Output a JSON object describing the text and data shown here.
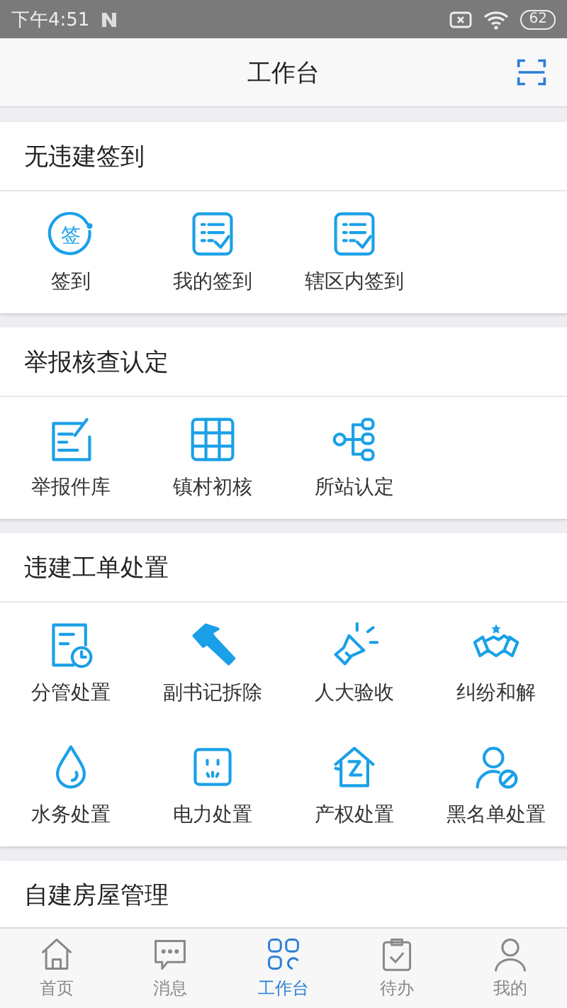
{
  "status_bar": {
    "time": "下午4:51",
    "battery": "62"
  },
  "header": {
    "title": "工作台"
  },
  "sections": [
    {
      "title": "无违建签到",
      "items": [
        {
          "label": "签到",
          "icon_text": "签"
        },
        {
          "label": "我的签到"
        },
        {
          "label": "辖区内签到"
        }
      ]
    },
    {
      "title": "举报核查认定",
      "items": [
        {
          "label": "举报件库"
        },
        {
          "label": "镇村初核"
        },
        {
          "label": "所站认定"
        }
      ]
    },
    {
      "title": "违建工单处置",
      "items": [
        {
          "label": "分管处置"
        },
        {
          "label": "副书记拆除"
        },
        {
          "label": "人大验收"
        },
        {
          "label": "纠纷和解"
        },
        {
          "label": "水务处置"
        },
        {
          "label": "电力处置"
        },
        {
          "label": "产权处置"
        },
        {
          "label": "黑名单处置"
        }
      ]
    },
    {
      "title": "自建房屋管理"
    }
  ],
  "tabs": [
    {
      "label": "首页",
      "selected": false
    },
    {
      "label": "消息",
      "selected": false
    },
    {
      "label": "工作台",
      "selected": true
    },
    {
      "label": "待办",
      "selected": false
    },
    {
      "label": "我的",
      "selected": false
    }
  ]
}
